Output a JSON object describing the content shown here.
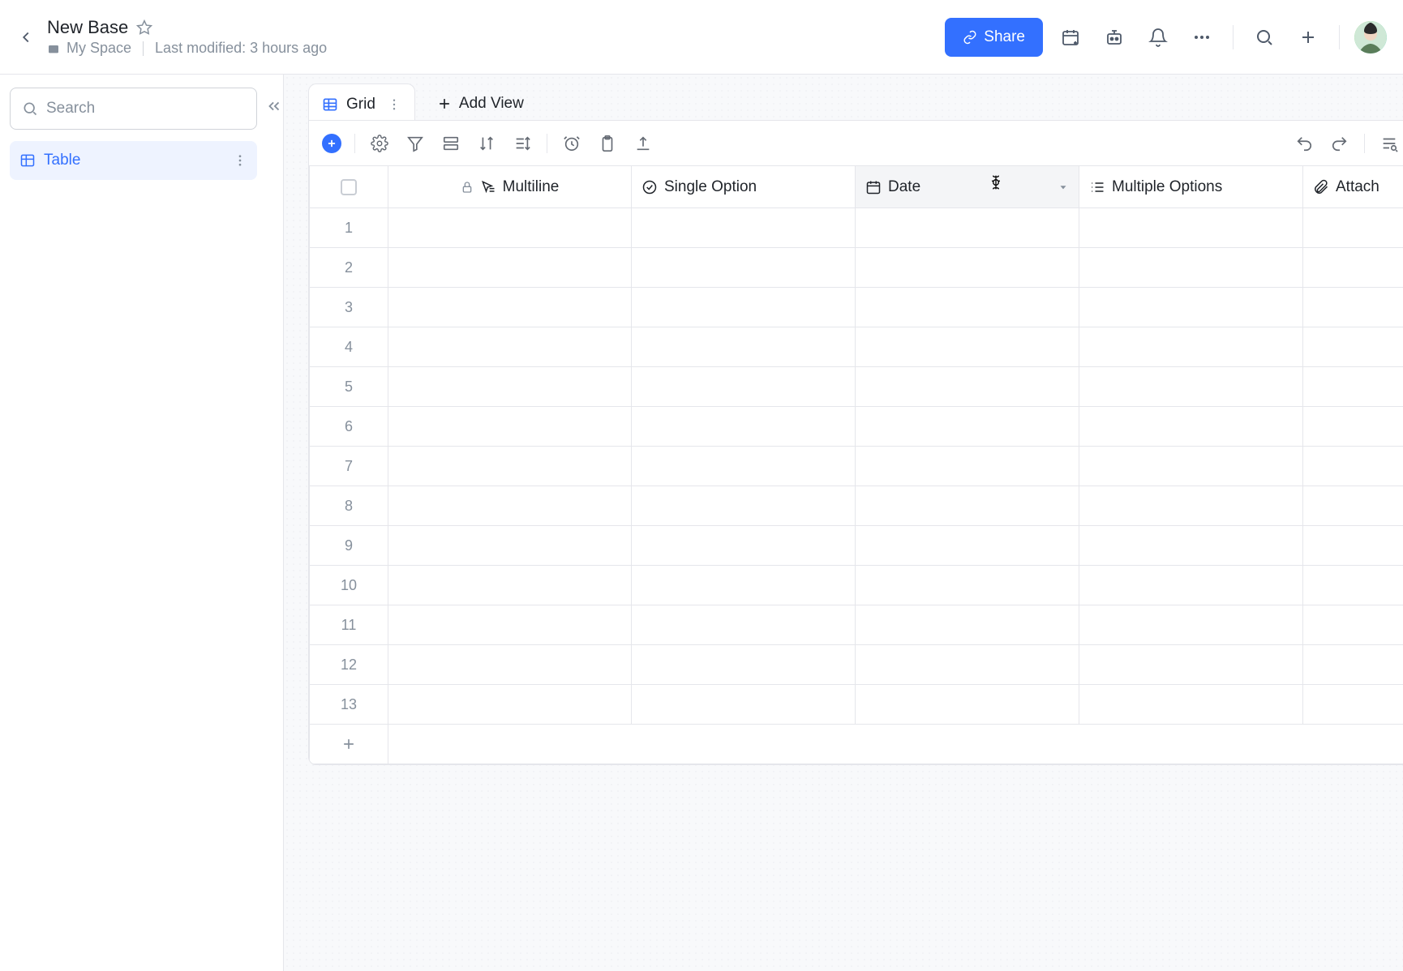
{
  "header": {
    "title": "New Base",
    "space": "My Space",
    "last_modified": "Last modified: 3 hours ago",
    "share_label": "Share"
  },
  "sidebar": {
    "search_placeholder": "Search",
    "items": [
      {
        "label": "Table"
      }
    ]
  },
  "views": {
    "active": {
      "label": "Grid"
    },
    "add_label": "Add View"
  },
  "columns": [
    {
      "label": "Multiline",
      "type": "text",
      "locked": true
    },
    {
      "label": "Single Option",
      "type": "select"
    },
    {
      "label": "Date",
      "type": "date"
    },
    {
      "label": "Multiple Options",
      "type": "multiselect"
    },
    {
      "label": "Attach",
      "type": "attachment"
    }
  ],
  "row_numbers": [
    "1",
    "2",
    "3",
    "4",
    "5",
    "6",
    "7",
    "8",
    "9",
    "10",
    "11",
    "12",
    "13"
  ]
}
